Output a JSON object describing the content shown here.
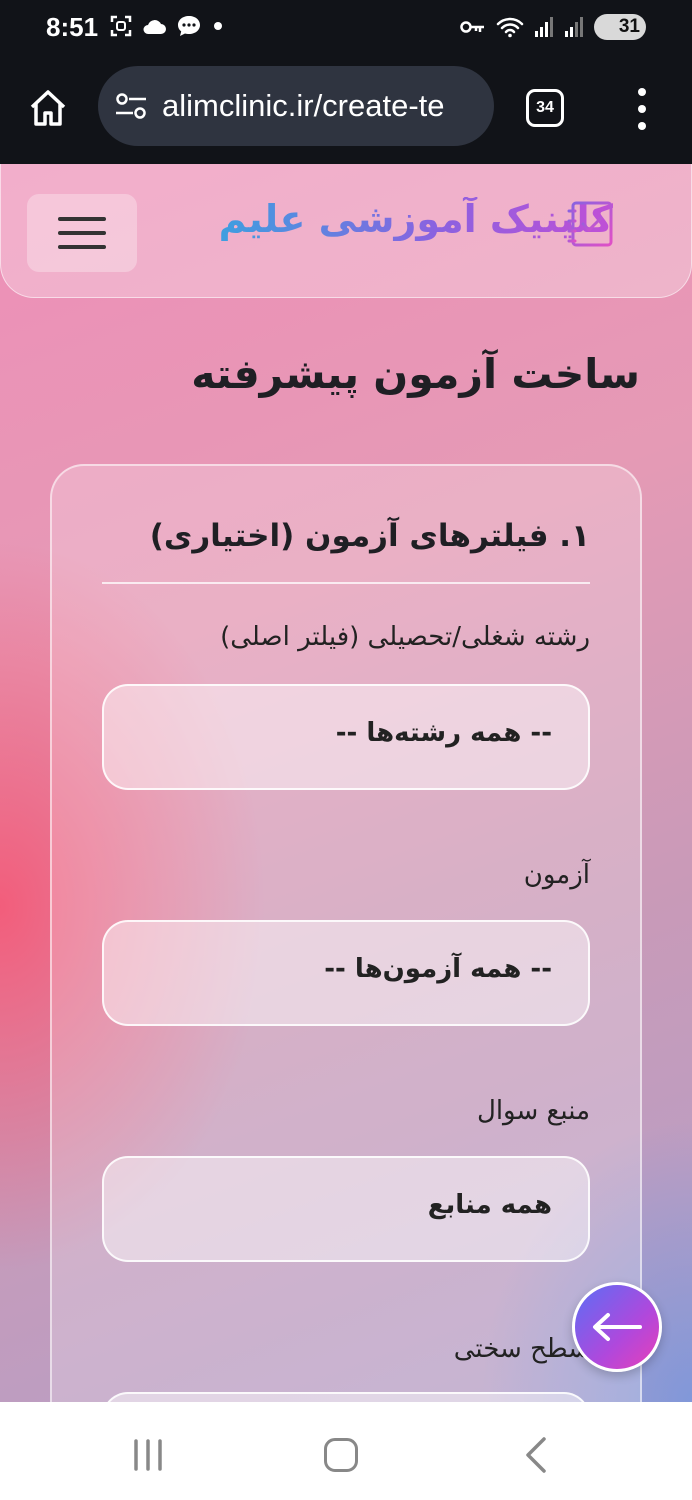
{
  "status_bar": {
    "time": "8:51",
    "battery": "31"
  },
  "browser": {
    "url": "alimclinic.ir/create-te",
    "tab_count": "34"
  },
  "site": {
    "brand": "کلینیک آموزشی علیم"
  },
  "page": {
    "title": "ساخت آزمون پیشرفته",
    "section_title": "۱. فیلترهای آزمون (اختیاری)",
    "fields": [
      {
        "label": "رشته شغلی/تحصیلی (فیلتر اصلی)",
        "value": "-- همه رشته‌ها --"
      },
      {
        "label": "آزمون",
        "value": "-- همه آزمون‌ها --"
      },
      {
        "label": "منبع سوال",
        "value": "همه منابع"
      },
      {
        "label": "سطح سختی",
        "value": ""
      }
    ]
  },
  "colors": {
    "brand_gradient_start": "#c04fd6",
    "brand_gradient_end": "#3d9fe0",
    "fab_gradient_start": "#5b6ef5",
    "fab_gradient_end": "#e83fb8"
  },
  "icons": {
    "status_left": [
      "screenshot-icon",
      "cloud-icon",
      "chat-icon",
      "dot-icon"
    ],
    "status_right": [
      "key-icon",
      "wifi-icon",
      "signal-icon",
      "signal-icon",
      "battery-icon"
    ],
    "browser": [
      "home-icon",
      "tune-icon",
      "tabs-icon",
      "more-vert-icon"
    ],
    "nav": [
      "recents-icon",
      "home-icon",
      "back-icon"
    ],
    "fab": "arrow-left-icon"
  }
}
